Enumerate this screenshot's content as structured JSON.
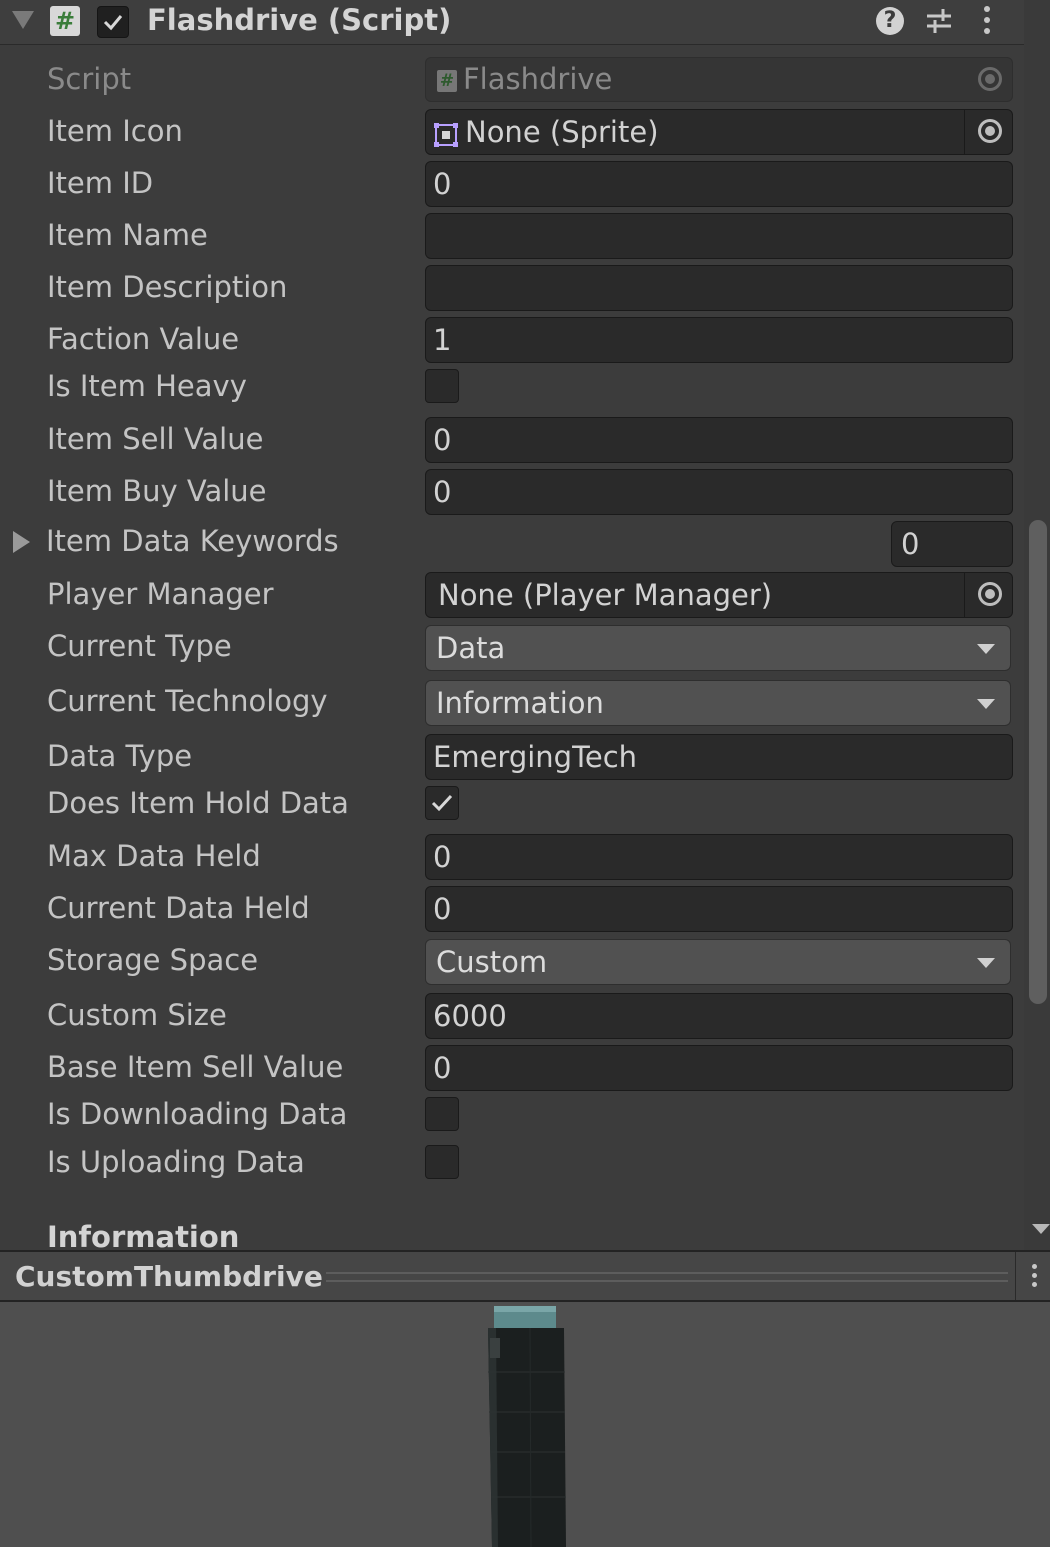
{
  "component": {
    "title": "Flashdrive (Script)",
    "enabled": true
  },
  "fields": {
    "script": {
      "label": "Script",
      "value": "Flashdrive"
    },
    "item_icon": {
      "label": "Item Icon",
      "value": "None (Sprite)"
    },
    "item_id": {
      "label": "Item ID",
      "value": "0"
    },
    "item_name": {
      "label": "Item Name",
      "value": ""
    },
    "item_description": {
      "label": "Item Description",
      "value": ""
    },
    "faction_value": {
      "label": "Faction Value",
      "value": "1"
    },
    "is_item_heavy": {
      "label": "Is Item Heavy",
      "checked": false
    },
    "item_sell_value": {
      "label": "Item Sell Value",
      "value": "0"
    },
    "item_buy_value": {
      "label": "Item Buy Value",
      "value": "0"
    },
    "item_data_keywords": {
      "label": "Item Data Keywords",
      "size": "0"
    },
    "player_manager": {
      "label": "Player Manager",
      "value": "None (Player Manager)"
    },
    "current_type": {
      "label": "Current Type",
      "value": "Data"
    },
    "current_technology": {
      "label": "Current Technology",
      "value": "Information"
    },
    "data_type": {
      "label": "Data Type",
      "value": "EmergingTech"
    },
    "does_item_hold_data": {
      "label": "Does Item Hold Data",
      "checked": true
    },
    "max_data_held": {
      "label": "Max Data Held",
      "value": "0"
    },
    "current_data_held": {
      "label": "Current Data Held",
      "value": "0"
    },
    "storage_space": {
      "label": "Storage Space",
      "value": "Custom"
    },
    "custom_size": {
      "label": "Custom Size",
      "value": "6000"
    },
    "base_item_sell_value": {
      "label": "Base Item Sell Value",
      "value": "0"
    },
    "is_downloading_data": {
      "label": "Is Downloading Data",
      "checked": false
    },
    "is_uploading_data": {
      "label": "Is Uploading Data",
      "checked": false
    }
  },
  "section_header": "Information",
  "preview": {
    "title": "CustomThumbdrive"
  },
  "icons": {
    "script": "script-hash-icon",
    "help": "help-icon",
    "presets": "presets-sliders-icon",
    "menu": "kebab-menu-icon",
    "object_picker": "object-picker-icon",
    "sprite": "sprite-icon"
  }
}
